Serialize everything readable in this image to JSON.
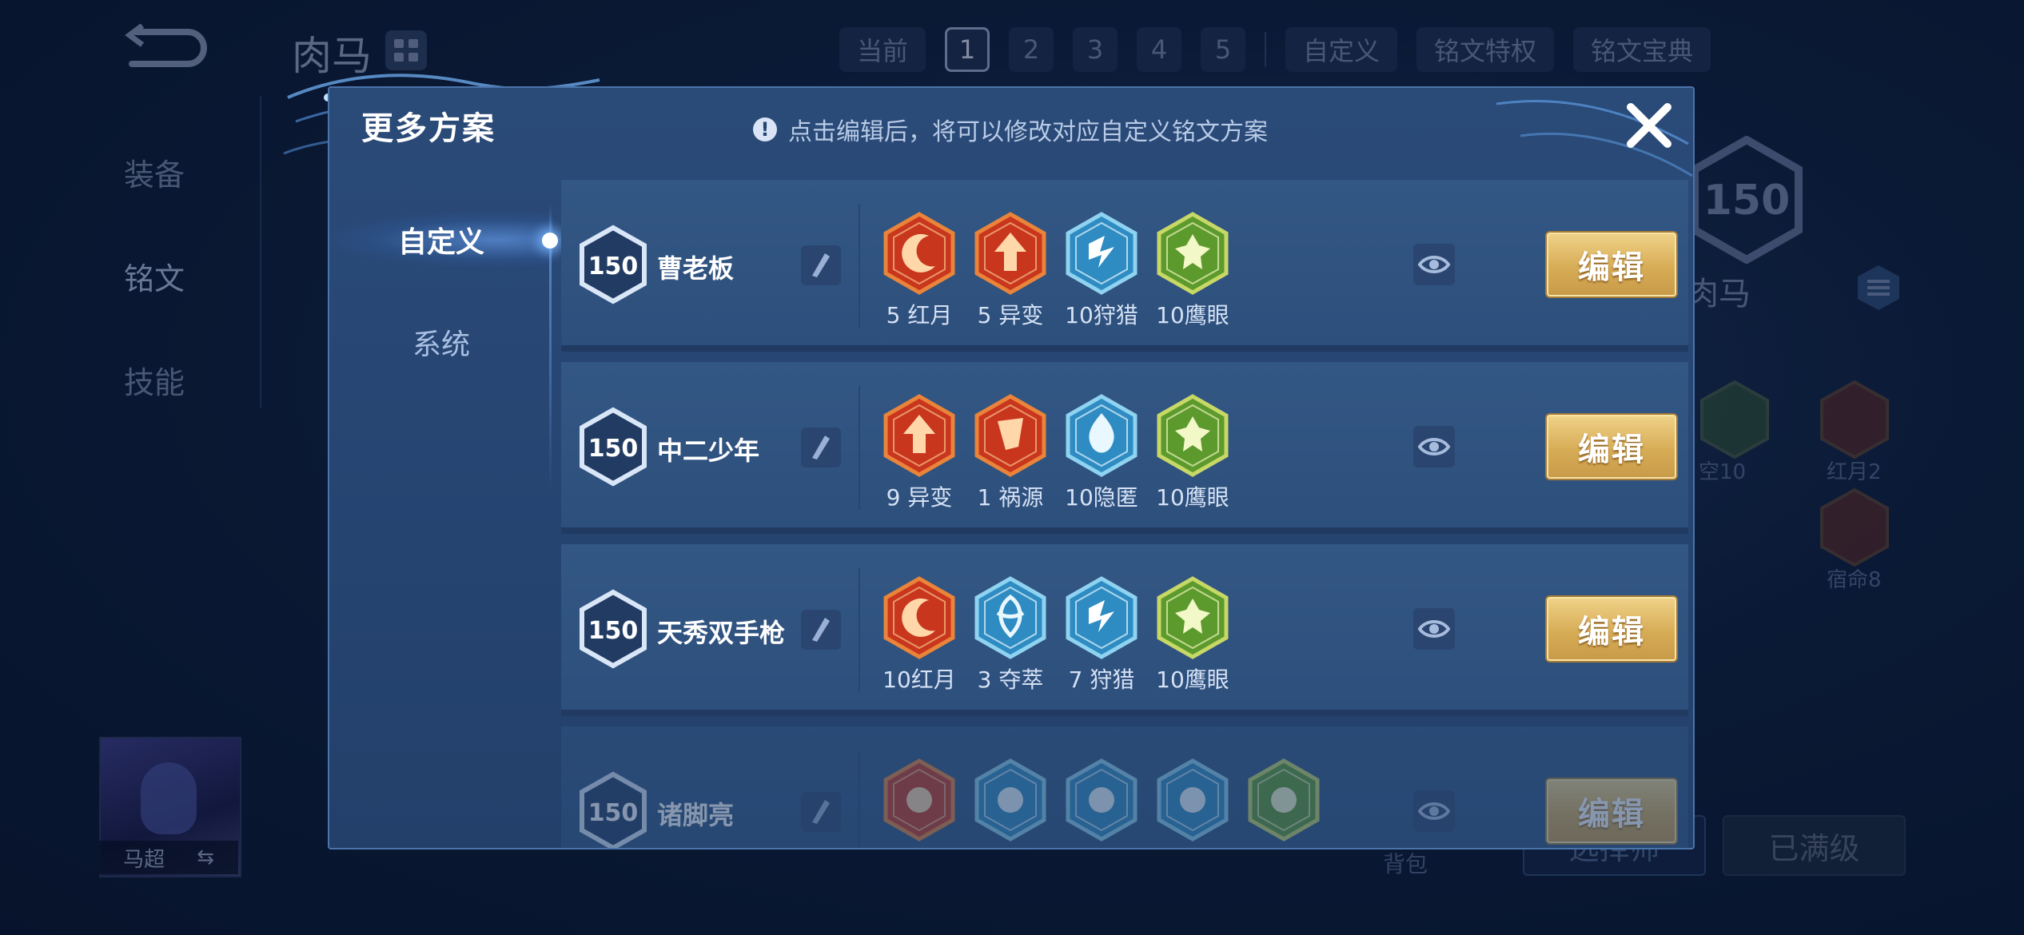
{
  "background": {
    "hero_build_name": "肉马",
    "plan_tabs": [
      "当前",
      "1",
      "2",
      "3",
      "4",
      "5",
      "自定义"
    ],
    "selected_plan": "1",
    "privilege_label": "铭文特权",
    "codex_label": "铭文宝典",
    "left_menu": [
      "装备",
      "铭文",
      "技能"
    ],
    "rune_level": "150",
    "right_name": "肉马",
    "rune_labels": [
      "空10",
      "红月2",
      "宿命8"
    ],
    "hero_portrait_name": "马超",
    "backpack_label": "背包",
    "choose_button": "选择师",
    "maxed_button": "已满级"
  },
  "modal": {
    "title": "更多方案",
    "hint": "点击编辑后，将可以修改对应自定义铭文方案",
    "side_tabs": [
      {
        "label": "自定义",
        "active": true
      },
      {
        "label": "系统",
        "active": false
      }
    ],
    "edit_label": "编辑",
    "schemes": [
      {
        "level": "150",
        "name": "曹老板",
        "runes": [
          {
            "label": "5 红月",
            "icon": "red-moon",
            "color": "red"
          },
          {
            "label": "5 异变",
            "icon": "mutation",
            "color": "red"
          },
          {
            "label": "10狩猎",
            "icon": "hunt",
            "color": "blue"
          },
          {
            "label": "10鹰眼",
            "icon": "hawk-eye",
            "color": "green"
          }
        ]
      },
      {
        "level": "150",
        "name": "中二少年",
        "runes": [
          {
            "label": "9 异变",
            "icon": "mutation",
            "color": "red"
          },
          {
            "label": "1 祸源",
            "icon": "calamity",
            "color": "red"
          },
          {
            "label": "10隐匿",
            "icon": "stealth",
            "color": "blue"
          },
          {
            "label": "10鹰眼",
            "icon": "hawk-eye",
            "color": "green"
          }
        ]
      },
      {
        "level": "150",
        "name": "天秀双手枪",
        "runes": [
          {
            "label": "10红月",
            "icon": "red-moon",
            "color": "red"
          },
          {
            "label": "3 夺萃",
            "icon": "plunder",
            "color": "blue"
          },
          {
            "label": "7 狩猎",
            "icon": "hunt",
            "color": "blue"
          },
          {
            "label": "10鹰眼",
            "icon": "hawk-eye",
            "color": "green"
          }
        ]
      },
      {
        "level": "150",
        "name": "诸脚亮",
        "runes": [
          {
            "label": "",
            "icon": "red",
            "color": "red"
          },
          {
            "label": "",
            "icon": "blue",
            "color": "blue"
          },
          {
            "label": "",
            "icon": "blue",
            "color": "blue"
          },
          {
            "label": "",
            "icon": "blue",
            "color": "blue"
          },
          {
            "label": "",
            "icon": "green",
            "color": "green"
          }
        ]
      }
    ]
  },
  "colors": {
    "rune_red_outer": "#e9843a",
    "rune_red_inner": "#c9361e",
    "rune_blue_outer": "#8fd3f0",
    "rune_blue_inner": "#2f8cc2",
    "rune_green_outer": "#c7d866",
    "rune_green_inner": "#5d9a2e",
    "edit_gold": "#d7ac56"
  }
}
